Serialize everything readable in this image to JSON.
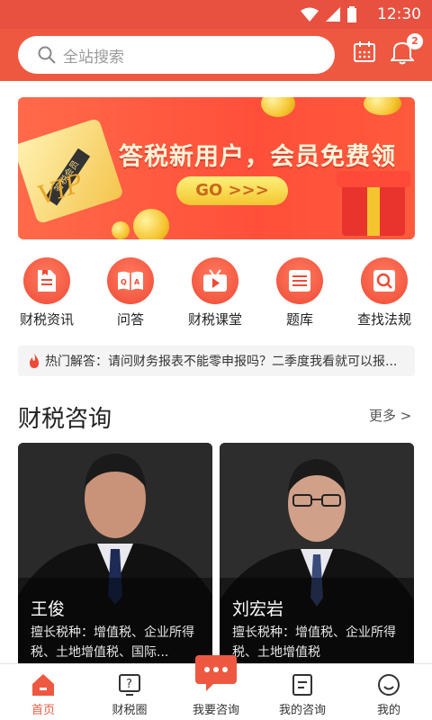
{
  "status": {
    "time": "12:30"
  },
  "header": {
    "search_placeholder": "全站搜索",
    "notification_count": "2"
  },
  "banner": {
    "headline": "答税新用户，会员免费领",
    "button": "GO >>>",
    "card_ribbon": "答税会员",
    "card_text": "VIP"
  },
  "nav": {
    "items": [
      {
        "label": "财税资讯",
        "icon": "news-icon"
      },
      {
        "label": "问答",
        "icon": "qa-book-icon"
      },
      {
        "label": "财税课堂",
        "icon": "tv-play-icon"
      },
      {
        "label": "题库",
        "icon": "list-icon"
      },
      {
        "label": "查找法规",
        "icon": "search-doc-icon"
      }
    ]
  },
  "hot": {
    "text": "热门解答：请问财务报表不能零申报吗？二季度我看就可以报..."
  },
  "section": {
    "title": "财税咨询",
    "more": "更多 >"
  },
  "consultants": [
    {
      "name": "王俊",
      "desc": "擅长税种：增值税、企业所得税、土地增值税、国际..."
    },
    {
      "name": "刘宏岩",
      "desc": "擅长税种：增值税、企业所得税、土地增值税"
    }
  ],
  "tabbar": {
    "tabs": [
      {
        "label": "首页",
        "active": true
      },
      {
        "label": "财税圈",
        "active": false
      },
      {
        "label": "我要咨询",
        "active": false
      },
      {
        "label": "我的咨询",
        "active": false
      },
      {
        "label": "我的",
        "active": false
      }
    ]
  },
  "colors": {
    "brand": "#ef5840",
    "status_bar": "#e8503f"
  }
}
